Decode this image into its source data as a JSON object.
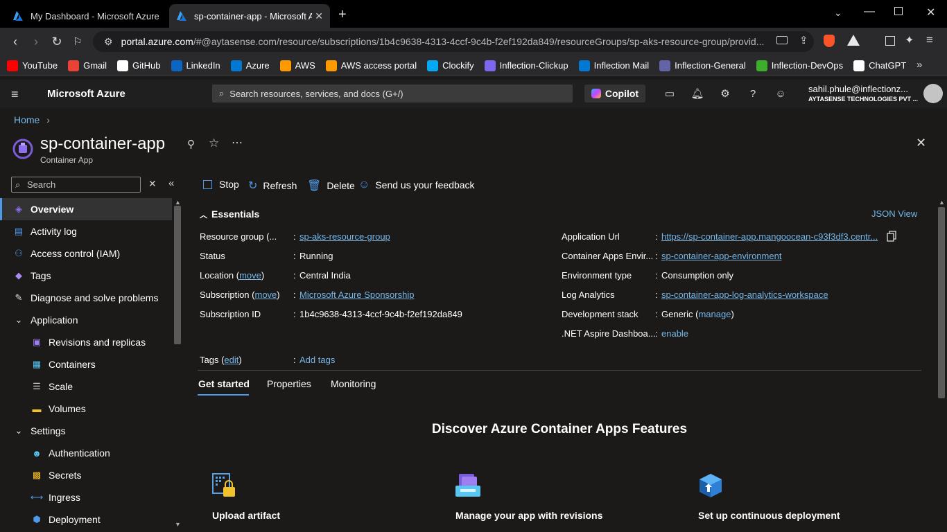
{
  "browser": {
    "tabs": [
      {
        "title": "My Dashboard - Microsoft Azure",
        "active": false
      },
      {
        "title": "sp-container-app - Microsoft A",
        "active": true
      }
    ],
    "url_host": "portal.azure.com",
    "url_path": "/#@aytasense.com/resource/subscriptions/1b4c9638-4313-4ccf-9c4b-f2ef192da849/resourceGroups/sp-aks-resource-group/provid...",
    "bookmarks": [
      {
        "label": "YouTube",
        "color": "#ff0000"
      },
      {
        "label": "Gmail",
        "color": "#ea4335"
      },
      {
        "label": "GitHub",
        "color": "#ffffff"
      },
      {
        "label": "LinkedIn",
        "color": "#0a66c2"
      },
      {
        "label": "Azure",
        "color": "#0078d4"
      },
      {
        "label": "AWS",
        "color": "#ff9900"
      },
      {
        "label": "AWS access portal",
        "color": "#ff9900"
      },
      {
        "label": "Clockify",
        "color": "#03a9f4"
      },
      {
        "label": "Inflection-Clickup",
        "color": "#7b68ee"
      },
      {
        "label": "Inflection Mail",
        "color": "#0078d4"
      },
      {
        "label": "Inflection-General",
        "color": "#6264a7"
      },
      {
        "label": "Inflection-DevOps",
        "color": "#3dae2b"
      },
      {
        "label": "ChatGPT",
        "color": "#ffffff"
      }
    ]
  },
  "azure": {
    "brand": "Microsoft Azure",
    "search_placeholder": "Search resources, services, and docs (G+/)",
    "copilot": "Copilot",
    "account_email": "sahil.phule@inflectionz...",
    "account_org": "AYTASENSE TECHNOLOGIES PVT ..."
  },
  "breadcrumb": "Home",
  "resource": {
    "name": "sp-container-app",
    "type": "Container App"
  },
  "sidebar": {
    "search_placeholder": "Search",
    "items": [
      {
        "label": "Overview",
        "icon": "overview-icon",
        "indent": 0,
        "active": true
      },
      {
        "label": "Activity log",
        "icon": "activity-log-icon",
        "indent": 0
      },
      {
        "label": "Access control (IAM)",
        "icon": "iam-icon",
        "indent": 0
      },
      {
        "label": "Tags",
        "icon": "tag-icon",
        "indent": 0
      },
      {
        "label": "Diagnose and solve problems",
        "icon": "wrench-icon",
        "indent": 0
      },
      {
        "label": "Application",
        "icon": "chevron-down-icon",
        "indent": 0
      },
      {
        "label": "Revisions and replicas",
        "icon": "revisions-icon",
        "indent": 1
      },
      {
        "label": "Containers",
        "icon": "containers-icon",
        "indent": 1
      },
      {
        "label": "Scale",
        "icon": "scale-icon",
        "indent": 1
      },
      {
        "label": "Volumes",
        "icon": "folder-icon",
        "indent": 1
      },
      {
        "label": "Settings",
        "icon": "chevron-down-icon",
        "indent": 0
      },
      {
        "label": "Authentication",
        "icon": "authentication-icon",
        "indent": 1
      },
      {
        "label": "Secrets",
        "icon": "secrets-icon",
        "indent": 1
      },
      {
        "label": "Ingress",
        "icon": "ingress-icon",
        "indent": 1
      },
      {
        "label": "Deployment",
        "icon": "deployment-icon",
        "indent": 1
      }
    ]
  },
  "toolbar": {
    "stop": "Stop",
    "refresh": "Refresh",
    "delete": "Delete",
    "feedback": "Send us your feedback"
  },
  "essentials": {
    "header": "Essentials",
    "json_view": "JSON View",
    "left": [
      {
        "label": "Resource group (...",
        "value": "sp-aks-resource-group",
        "link": true
      },
      {
        "label": "Status",
        "value": "Running",
        "link": false
      },
      {
        "label_pre": "Location (",
        "label_link": "move",
        "label_post": ")",
        "value": "Central India",
        "link": false
      },
      {
        "label_pre": "Subscription (",
        "label_link": "move",
        "label_post": ")",
        "value": "Microsoft Azure Sponsorship",
        "link": true
      },
      {
        "label": "Subscription ID",
        "value": "1b4c9638-4313-4ccf-9c4b-f2ef192da849",
        "link": false
      }
    ],
    "right": [
      {
        "label": "Application Url",
        "value": "https://sp-container-app.mangoocean-c93f3df3.centr...",
        "link": true
      },
      {
        "label": "Container Apps Envir...",
        "value": "sp-container-app-environment",
        "link": true
      },
      {
        "label": "Environment type",
        "value": "Consumption only",
        "link": false
      },
      {
        "label": "Log Analytics",
        "value": "sp-container-app-log-analytics-workspace",
        "link": true
      },
      {
        "label": "Development stack",
        "value_pre": "Generic (",
        "value_link": "manage",
        "value_post": ")"
      },
      {
        "label": ".NET Aspire Dashboa...",
        "value": "enable",
        "link": "plain"
      }
    ],
    "tags_label_pre": "Tags (",
    "tags_label_link": "edit",
    "tags_label_post": ")",
    "tags_value": "Add tags"
  },
  "page_tabs": [
    "Get started",
    "Properties",
    "Monitoring"
  ],
  "features": {
    "title": "Discover Azure Container Apps Features",
    "cards": [
      "Upload artifact",
      "Manage your app with revisions",
      "Set up continuous deployment"
    ]
  }
}
